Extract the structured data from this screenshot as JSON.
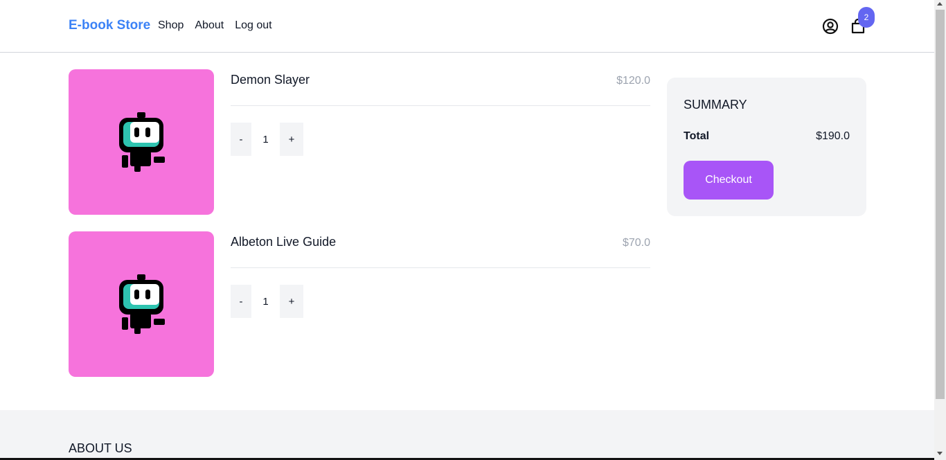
{
  "header": {
    "brand": "E-book Store",
    "nav": [
      {
        "label": "Shop"
      },
      {
        "label": "About"
      },
      {
        "label": "Log out"
      }
    ],
    "user_icon": "user-circle-icon",
    "cart_icon": "shopping-bag-icon",
    "cart_count": "2"
  },
  "cart": {
    "items": [
      {
        "title": "Demon Slayer",
        "price": "$120.0",
        "quantity": "1",
        "minus_label": "-",
        "plus_label": "+",
        "thumbnail_icon": "robot-icon"
      },
      {
        "title": "Albeton Live Guide",
        "price": "$70.0",
        "quantity": "1",
        "minus_label": "-",
        "plus_label": "+",
        "thumbnail_icon": "robot-icon"
      }
    ]
  },
  "summary": {
    "title": "SUMMARY",
    "total_label": "Total",
    "total_value": "$190.0",
    "checkout_label": "Checkout"
  },
  "footer": {
    "title": "ABOUT US"
  },
  "colors": {
    "brand": "#3b82f6",
    "thumbnail_bg": "#f673dc",
    "checkout_bg": "#a855f7",
    "badge_bg": "#6366f1",
    "robot_face": "#2ec4b0"
  }
}
